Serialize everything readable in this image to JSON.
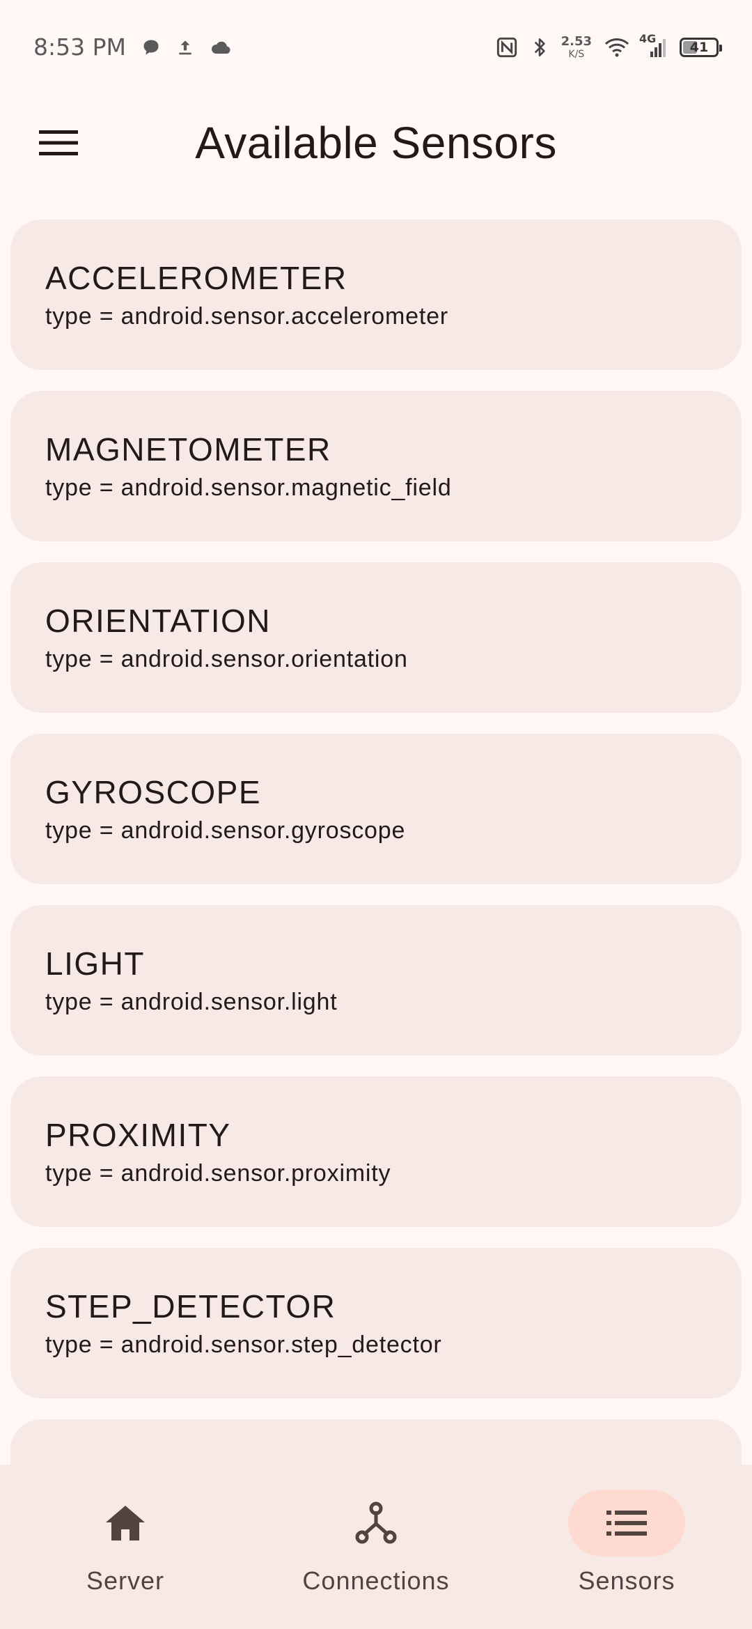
{
  "status_bar": {
    "time": "8:53 PM",
    "net_speed_value": "2.53",
    "net_speed_unit": "K/S",
    "network_type": "4G",
    "battery_level": "41",
    "left_icons": [
      "chat-bubble-icon",
      "upload-icon",
      "cloud-icon"
    ],
    "right_icons": [
      "nfc-icon",
      "bluetooth-icon",
      "wifi-icon",
      "signal-icon",
      "battery-icon"
    ]
  },
  "top_bar": {
    "title": "Available Sensors",
    "menu_icon": "menu-icon"
  },
  "sensors": [
    {
      "name": "ACCELEROMETER",
      "type": "type = android.sensor.accelerometer"
    },
    {
      "name": "MAGNETOMETER",
      "type": "type = android.sensor.magnetic_field"
    },
    {
      "name": "ORIENTATION",
      "type": "type = android.sensor.orientation"
    },
    {
      "name": "GYROSCOPE",
      "type": "type = android.sensor.gyroscope"
    },
    {
      "name": "LIGHT",
      "type": "type = android.sensor.light"
    },
    {
      "name": "PROXIMITY",
      "type": "type = android.sensor.proximity"
    },
    {
      "name": "STEP_DETECTOR",
      "type": "type = android.sensor.step_detector"
    },
    {
      "name": "",
      "type": ""
    }
  ],
  "bottom_nav": {
    "items": [
      {
        "label": "Server",
        "icon": "home-icon",
        "active": false
      },
      {
        "label": "Connections",
        "icon": "hub-icon",
        "active": false
      },
      {
        "label": "Sensors",
        "icon": "list-icon",
        "active": true
      }
    ]
  },
  "colors": {
    "background": "#FFF8F6",
    "card": "#F6E9E6",
    "active_indicator": "#FFDAD0",
    "text": "#231917",
    "nav_text": "#51433F"
  }
}
